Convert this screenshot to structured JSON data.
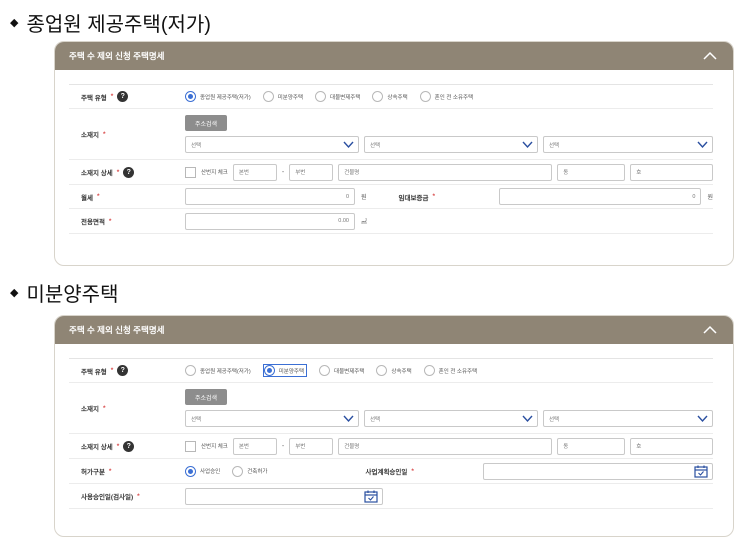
{
  "section1": {
    "bullet": "◆",
    "title": "종업원 제공주택(저가)",
    "panel_title": "주택 수 제외 신청 주택명세",
    "labels": {
      "house_type": "주택 유형",
      "location": "소재지",
      "location_detail": "소재지 상세",
      "monthly_rent": "월세",
      "lease_deposit": "임대보증금",
      "exclusive_area": "전용면적"
    },
    "radio_options": [
      "종업원 제공주택(저가)",
      "미분양주택",
      "대물변제주택",
      "상속주택",
      "혼인 전 소유주택"
    ],
    "address_button": "주소검색",
    "selects": [
      "선택",
      "선택",
      "선택"
    ],
    "detail": {
      "mountain_check": "산번지 체크",
      "main_no": "본번",
      "dash": "-",
      "sub_no": "부번",
      "building": "건물명",
      "dong": "동",
      "ho": "호"
    },
    "monthly_rent_value": "0",
    "monthly_rent_unit": "원",
    "deposit_value": "0",
    "deposit_unit": "원",
    "area_value": "0.00",
    "area_unit": "㎡"
  },
  "section2": {
    "bullet": "◆",
    "title": "미분양주택",
    "panel_title": "주택 수 제외 신청 주택명세",
    "labels": {
      "house_type": "주택 유형",
      "location": "소재지",
      "location_detail": "소재지 상세",
      "permit_type": "허가구분",
      "plan_approval_date": "사업계획승인일",
      "use_approval_date": "사용승인일(검사일)"
    },
    "radio_options": [
      "종업원 제공주택(저가)",
      "미분양주택",
      "대물변제주택",
      "상속주택",
      "혼인 전 소유주택"
    ],
    "address_button": "주소검색",
    "selects": [
      "선택",
      "선택",
      "선택"
    ],
    "detail": {
      "mountain_check": "산번지 체크",
      "main_no": "본번",
      "dash": "-",
      "sub_no": "부번",
      "building": "건물명",
      "dong": "동",
      "ho": "호"
    },
    "permit_options": [
      "사업승인",
      "건축허가"
    ]
  },
  "required_mark": "*",
  "help_mark": "?",
  "colors": {
    "header_bg": "#8f8575",
    "accent": "#3b6fd4",
    "required": "#d94a4a"
  },
  "icons": [
    "collapse-chevron-icon",
    "help-icon",
    "dropdown-arrow-icon",
    "calendar-icon"
  ]
}
